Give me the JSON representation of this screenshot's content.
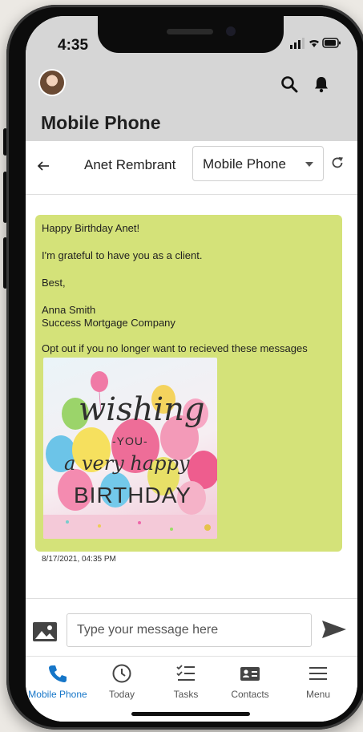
{
  "status_bar": {
    "time": "4:35"
  },
  "header": {
    "title": "Mobile Phone"
  },
  "conversation": {
    "contact_name": "Anet Rembrant",
    "channel": "Mobile Phone"
  },
  "message": {
    "lines": [
      "Happy Birthday Anet!",
      "I'm grateful to have you as a client.",
      "Best,",
      "Anna Smith",
      "Success Mortgage Company",
      "Opt out if you no longer want to recieved these messages"
    ],
    "image": {
      "line1": "wishing",
      "line2": "-YOU-",
      "line3": "a very happy",
      "line4": "BIRTHDAY"
    },
    "timestamp": "8/17/2021, 04:35 PM"
  },
  "composer": {
    "placeholder": "Type your message here"
  },
  "tabs": [
    {
      "label": "Mobile Phone",
      "icon": "phone-icon"
    },
    {
      "label": "Today",
      "icon": "clock-icon"
    },
    {
      "label": "Tasks",
      "icon": "checklist-icon"
    },
    {
      "label": "Contacts",
      "icon": "contact-card-icon"
    },
    {
      "label": "Menu",
      "icon": "hamburger-icon"
    }
  ],
  "colors": {
    "accent": "#1676c8",
    "header_bg": "#d6d6d6",
    "bubble": "#d4e279"
  }
}
